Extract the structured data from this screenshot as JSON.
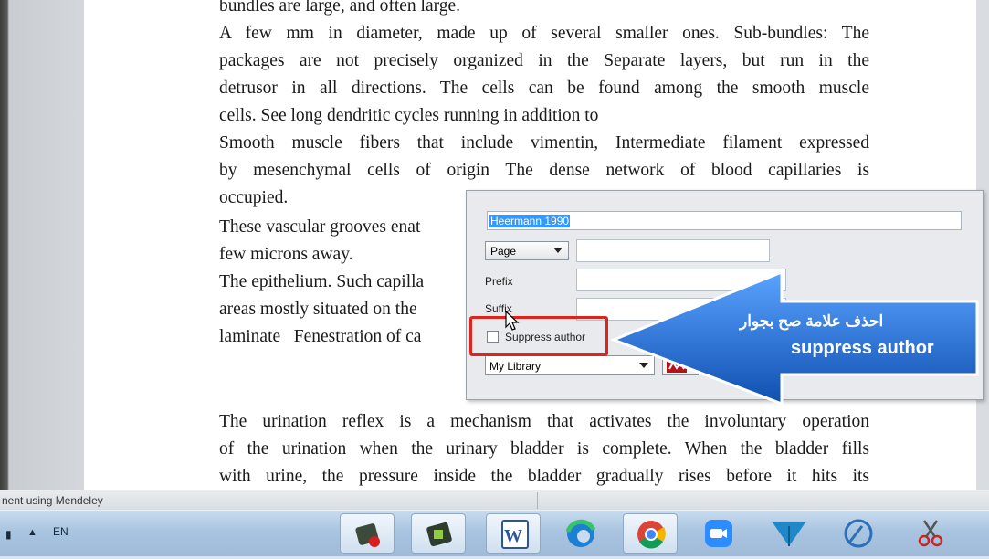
{
  "document": {
    "lines": [
      "bundles are large, and often large.",
      "A few mm in diameter, made up of several smaller ones. Sub-bundles: The",
      "packages are not precisely organized in the Separate layers, but run in the",
      "detrusor in all directions. The cells can be found among the smooth muscle",
      "cells. See long dendritic cycles running in addition to",
      "Smooth muscle fibers that include vimentin, Intermediate filament expressed",
      "by mesenchymal cells of origin The dense network of blood capillaries is",
      "occupied.",
      "These vascular grooves enat",
      "few microns away.",
      "The epithelium. Such capilla",
      "areas mostly situated on the",
      "laminate   Fenestration of ca",
      "The urination reflex is a mechanism that activates the involuntary operation",
      "of the urination when the urinary bladder is complete. When the bladder fills",
      "with urine, the pressure inside the bladder gradually rises before it hits its"
    ]
  },
  "citation_dialog": {
    "citation_text": "Heermann 1990",
    "locator_type": "Page",
    "prefix_label": "Prefix",
    "suffix_label": "Suffix",
    "suppress_author_label": "Suppress author",
    "suppress_author_checked": false,
    "library": "My Library"
  },
  "callout": {
    "arabic_text": "احذف علامة صح بجوار",
    "english_text": "suppress author",
    "color": "#1f5fbf"
  },
  "status_bar": {
    "text": "nent using Mendeley"
  },
  "taskbar": {
    "tray_lang": "EN",
    "apps": [
      "camtasia-recorder-icon",
      "camtasia-studio-icon",
      "word-icon",
      "edge-icon",
      "chrome-icon",
      "zoom-icon",
      "paper-plane-icon",
      "screen-cast-icon",
      "snipping-tool-icon"
    ]
  },
  "colors": {
    "highlight": "#3399ff",
    "red_frame": "#e0241b",
    "taskbar": "#a9c4e0"
  }
}
